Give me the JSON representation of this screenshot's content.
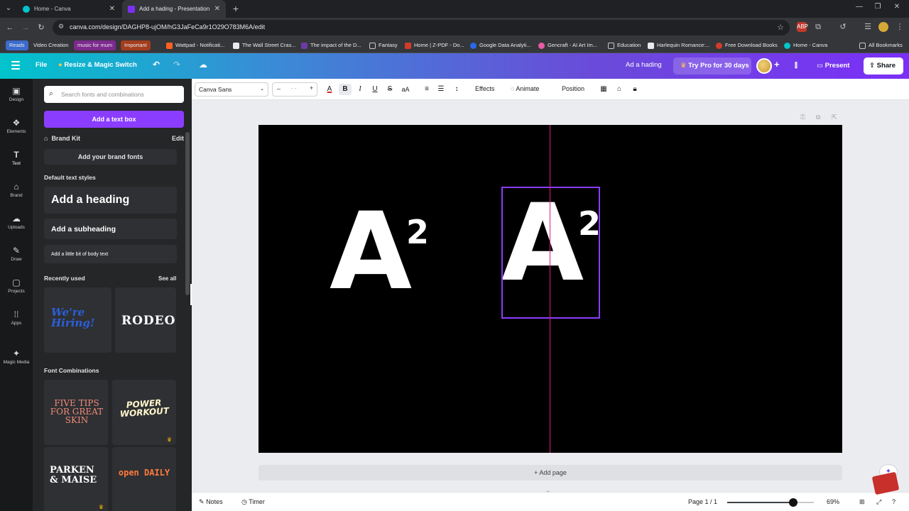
{
  "browser": {
    "tabs": [
      {
        "title": "Home - Canva",
        "active": false
      },
      {
        "title": "Add a hading - Presentation",
        "active": true
      }
    ],
    "url": "canva.com/design/DAGHP8-ujOM/hG3JaFeCa9r1O29O783M6A/edit",
    "bookmarks": [
      {
        "label": "Reads"
      },
      {
        "label": "Video Creation"
      },
      {
        "label": "music for mum"
      },
      {
        "label": "Important"
      },
      {
        "label": "Wattpad - Notificati..."
      },
      {
        "label": "The Wall Street Cras..."
      },
      {
        "label": "The impact of the D..."
      },
      {
        "label": "Fantasy"
      },
      {
        "label": "Home | Z-PDF - Do..."
      },
      {
        "label": "Google Data Analyti..."
      },
      {
        "label": "Gencraft - AI Art Im..."
      },
      {
        "label": "Education"
      },
      {
        "label": "Harlequin Romance:..."
      },
      {
        "label": "Free Download Books"
      },
      {
        "label": "Home - Canva"
      }
    ],
    "all_bookmarks": "All Bookmarks"
  },
  "header": {
    "file": "File",
    "resize": "Resize & Magic Switch",
    "doc_title": "Ad a hading",
    "try_pro": "Try Pro for 30 days",
    "present": "Present",
    "share": "Share"
  },
  "rail": [
    {
      "label": "Design",
      "icon": "design-icon"
    },
    {
      "label": "Elements",
      "icon": "elements-icon"
    },
    {
      "label": "Text",
      "icon": "text-icon"
    },
    {
      "label": "Brand",
      "icon": "brand-icon"
    },
    {
      "label": "Uploads",
      "icon": "uploads-icon"
    },
    {
      "label": "Draw",
      "icon": "draw-icon"
    },
    {
      "label": "Projects",
      "icon": "projects-icon"
    },
    {
      "label": "Apps",
      "icon": "apps-icon"
    },
    {
      "label": "Magic Media",
      "icon": "magic-media-icon"
    }
  ],
  "panel": {
    "search_placeholder": "Search fonts and combinations",
    "add_text_box": "Add a text box",
    "brand_kit": "Brand Kit",
    "brand_kit_edit": "Edit",
    "add_brand_fonts": "Add your brand fonts",
    "default_styles": "Default text styles",
    "heading": "Add a heading",
    "subheading": "Add a subheading",
    "body": "Add a little bit of body text",
    "recently_used": "Recently used",
    "see_all": "See all",
    "recent": [
      "We're Hiring!",
      "RODEO"
    ],
    "font_combinations": "Font Combinations",
    "combos": [
      "FIVE TIPS FOR GREAT SKIN",
      "POWER WORKOUT",
      "PARKEN & MAISE",
      "open DAILY"
    ]
  },
  "toolbar": {
    "font": "Canva Sans",
    "size_minus": "–",
    "size_value": "- -",
    "size_plus": "+",
    "effects": "Effects",
    "animate": "Animate",
    "position": "Position"
  },
  "canvas": {
    "base_left": "A",
    "exp_left": "2",
    "base_right": "A",
    "exp_right": "2",
    "add_page": "+ Add page"
  },
  "footer": {
    "notes": "Notes",
    "timer": "Timer",
    "page": "Page 1 / 1",
    "zoom": "69%",
    "zoom_fraction": 0.69
  },
  "colors": {
    "accent": "#8b3dff",
    "guide": "#e01a86"
  }
}
